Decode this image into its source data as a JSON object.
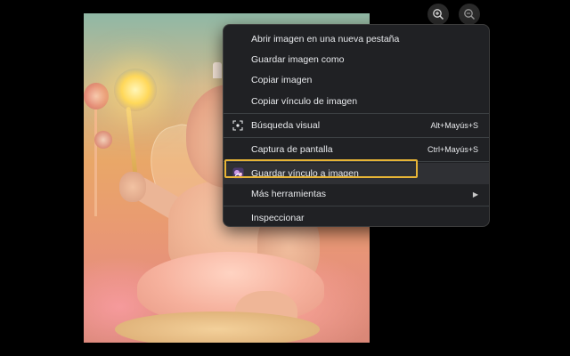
{
  "viewer": {
    "image_alt": "baby-fairy-image",
    "zoom_in_icon": "zoom-in-icon",
    "zoom_out_icon": "zoom-out-icon"
  },
  "context_menu": {
    "items": [
      {
        "label": "Abrir imagen en una nueva pestaña"
      },
      {
        "label": "Guardar imagen como"
      },
      {
        "label": "Copiar imagen"
      },
      {
        "label": "Copiar vínculo de imagen"
      },
      {
        "label": "Búsqueda visual",
        "shortcut": "Alt+Mayús+S",
        "icon": "visual-search-icon"
      },
      {
        "label": "Captura de pantalla",
        "shortcut": "Ctrl+Mayús+S"
      },
      {
        "label": "Guardar vínculo a imagen",
        "icon": "extension-icon",
        "highlighted": true
      },
      {
        "label": "Más herramientas",
        "submenu": true,
        "icon": "chevron-right-icon"
      },
      {
        "label": "Inspeccionar"
      }
    ]
  },
  "colors": {
    "menu_background": "#202124",
    "menu_text": "#e8eaed",
    "highlight_outline": "#e7b436"
  }
}
